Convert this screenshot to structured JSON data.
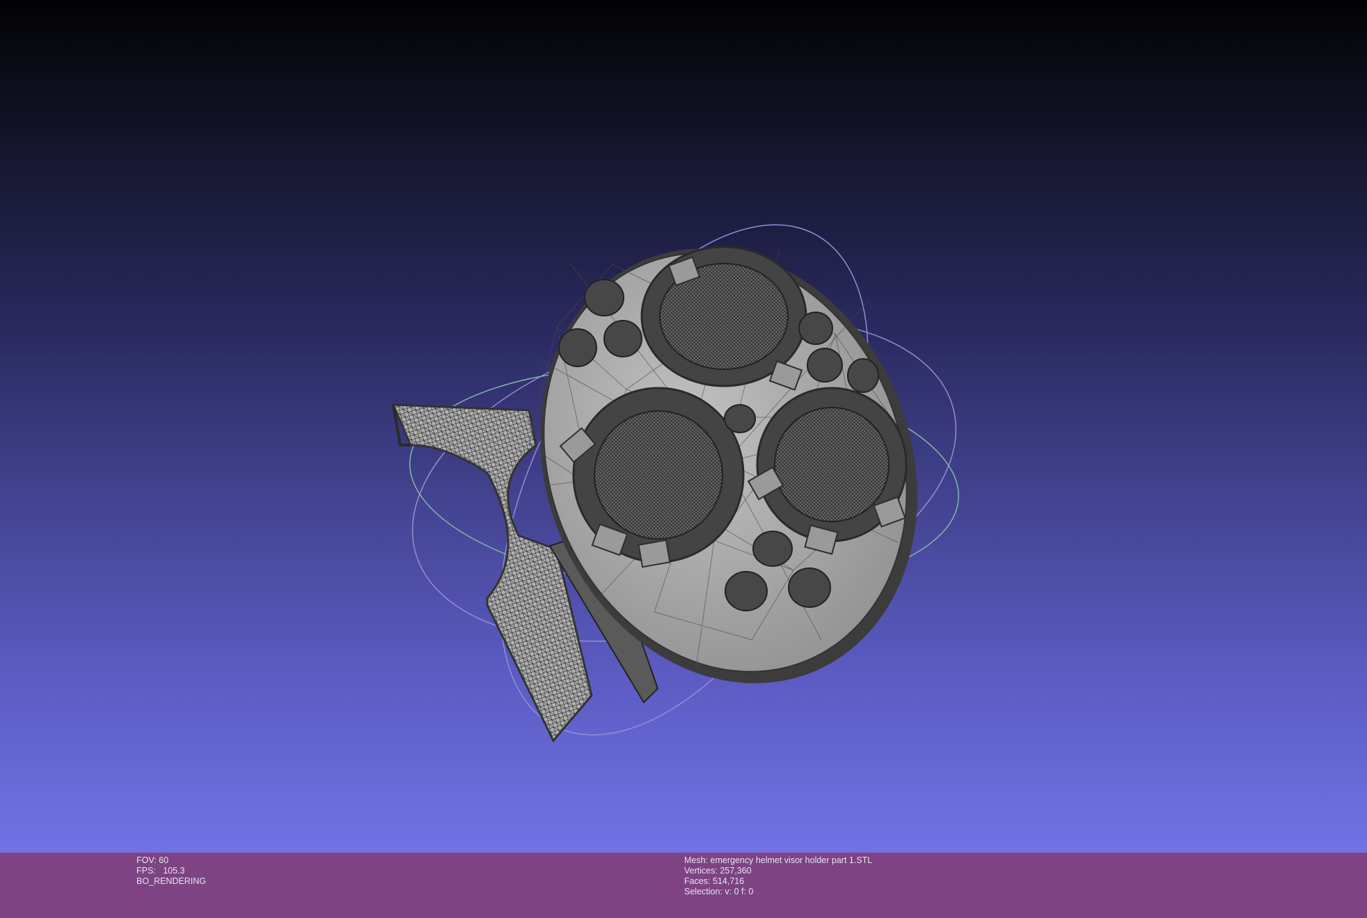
{
  "viewport": {
    "background_top": "#020204",
    "background_bottom": "#7272e6",
    "mesh_color": "#a8a8a8",
    "wire_color": "#3c3c3c"
  },
  "render_info": {
    "fov": "FOV: 60",
    "fps": "FPS:   105.3",
    "mode": "BO_RENDERING"
  },
  "mesh_info": {
    "name": "Mesh: emergency helmet visor holder part 1.STL",
    "vertices": "Vertices: 257,360",
    "faces": "Faces: 514,716",
    "selection": "Selection: v: 0 f: 0"
  },
  "status_bar": {
    "color": "#7d4383"
  }
}
